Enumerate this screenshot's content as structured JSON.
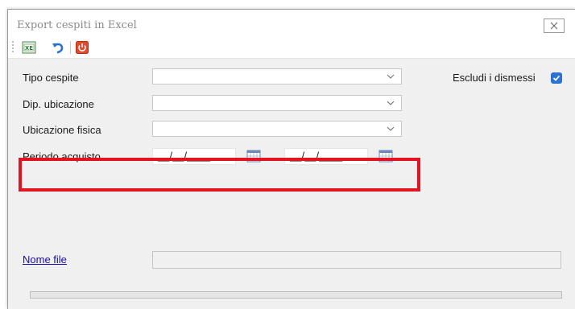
{
  "window": {
    "title": "Export cespiti in Excel",
    "close_icon": "close-x-icon"
  },
  "toolbar": {
    "buttons": [
      {
        "name": "excel-export-icon",
        "color": "#2e7d32"
      },
      {
        "name": "undo-icon",
        "color": "#2a6fd6"
      },
      {
        "name": "power-exit-icon",
        "color": "#d9381e"
      }
    ]
  },
  "form": {
    "tipo_cespite": {
      "label": "Tipo cespite",
      "value": ""
    },
    "dip_ubicazione": {
      "label": "Dip. ubicazione",
      "value": ""
    },
    "ubicazione_fisica": {
      "label": "Ubicazione fisica",
      "value": ""
    },
    "escludi_dismessi": {
      "label": "Escludi i dismessi",
      "checked": true
    },
    "periodo_acquisto": {
      "label": "Periodo acquisto",
      "from": "__/__/____",
      "to": "__/__/____"
    },
    "nome_file": {
      "label": "Nome file",
      "value": ""
    }
  },
  "colors": {
    "highlight": "#e3131f",
    "checkbox": "#2a72d6",
    "link": "#1a0dab",
    "form_bg": "#f0f0f0"
  }
}
